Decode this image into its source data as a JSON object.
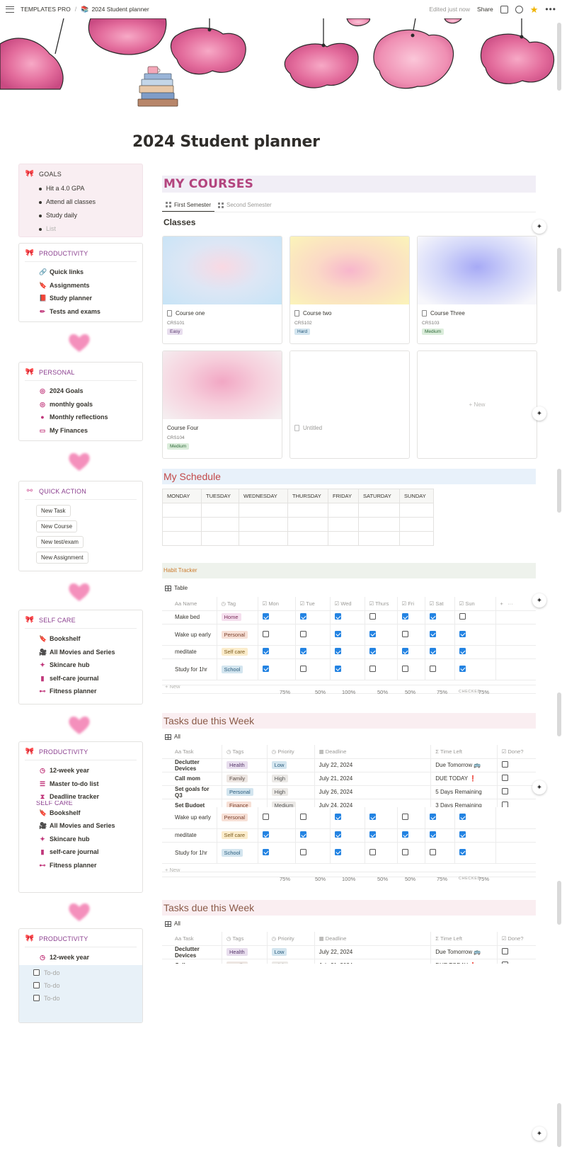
{
  "topbar": {
    "workspace": "TEMPLATES PRO",
    "page": "2024 Student planner",
    "page_emoji": "📚",
    "edited": "Edited just now",
    "share": "Share",
    "icons": [
      "menu-icon",
      "comment-icon",
      "clock-icon",
      "star-icon",
      "more-icon"
    ]
  },
  "title": "2024 Student planner",
  "sidebar": {
    "goals": {
      "header": "GOALS",
      "items": [
        "Hit a 4.0 GPA",
        "Attend all classes",
        "Study daily"
      ],
      "placeholder": "List"
    },
    "productivity": {
      "header": "PRODUCTIVITY",
      "items": [
        "Quick links",
        "Assignments",
        "Study planner",
        "Tests and exams"
      ]
    },
    "personal": {
      "header": "PERSONAL",
      "items": [
        "2024 Goals",
        "monthly goals",
        "Monthly reflections",
        "My Finances"
      ]
    },
    "quick_action": {
      "header": "QUICK ACTION",
      "buttons": [
        "New Task",
        "New Course",
        "New test/exam",
        "New Assignment"
      ]
    },
    "self_care": {
      "header": "SELF CARE",
      "items": [
        "Bookshelf",
        "All Movies and Series",
        "Skincare hub",
        "self-care journal",
        "Fitness planner"
      ]
    },
    "productivity2": {
      "header": "PRODUCTIVITY",
      "items": [
        "12-week year",
        "Master to-do list",
        "Deadline tracker"
      ]
    },
    "self_care2": {
      "header": "SELF CARE",
      "items": [
        "Bookshelf",
        "All Movies and Series",
        "Skincare hub",
        "self-care journal",
        "Fitness planner"
      ]
    },
    "productivity3": {
      "header": "PRODUCTIVITY",
      "items": [
        "12-week year"
      ],
      "todo_placeholder": "To-do"
    }
  },
  "courses": {
    "heading": "MY COURSES",
    "tabs": [
      "First Semester",
      "Second Semester"
    ],
    "subheading": "Classes",
    "cards": [
      {
        "title": "Course one",
        "code": "CRS101",
        "level": "Easy"
      },
      {
        "title": "Course two",
        "code": "CRS102",
        "level": "Hard"
      },
      {
        "title": "Course Three",
        "code": "CRS103",
        "level": "Medium"
      },
      {
        "title": "Course Four",
        "code": "CRS104",
        "level": "Medium"
      },
      {
        "title": "Untitled"
      }
    ],
    "new_label": "+ New"
  },
  "schedule": {
    "heading": "My Schedule",
    "days": [
      "MONDAY",
      "TUESDAY",
      "WEDNESDAY",
      "THURSDAY",
      "FRIDAY",
      "SATURDAY",
      "SUNDAY"
    ]
  },
  "habit": {
    "heading": "Habit Tracker",
    "view": "Table",
    "columns": [
      "Aa Name",
      "Tag",
      "Mon",
      "Tue",
      "Wed",
      "Thurs",
      "Fri",
      "Sat",
      "Sun"
    ],
    "rows": [
      {
        "name": "Make bed",
        "tag": "Home",
        "checks": [
          true,
          true,
          true,
          false,
          true,
          true,
          false
        ]
      },
      {
        "name": "Wake up early",
        "tag": "Personal",
        "checks": [
          false,
          false,
          true,
          true,
          false,
          true,
          true
        ]
      },
      {
        "name": "meditate",
        "tag": "Self care",
        "checks": [
          true,
          true,
          true,
          true,
          true,
          true,
          true
        ]
      },
      {
        "name": "Study for 1hr",
        "tag": "School",
        "checks": [
          true,
          false,
          true,
          false,
          false,
          false,
          true
        ]
      }
    ],
    "new_label": "+ New",
    "calc": [
      "75%",
      "50%",
      "100%",
      "50%",
      "50%",
      "75%",
      "75%"
    ],
    "checked_label": "CHECKED"
  },
  "tasks": {
    "heading": "Tasks due this Week",
    "view": "All",
    "columns": [
      "Aa Task",
      "Tags",
      "Priority",
      "Deadline",
      "Time Left",
      "Done?"
    ],
    "rows": [
      {
        "task": "Declutter Devices",
        "tag": "Health",
        "priority": "Low",
        "deadline": "July 22, 2024",
        "left": "Due Tomorrow 🚌"
      },
      {
        "task": "Call mom",
        "tag": "Family",
        "priority": "High",
        "deadline": "July 21, 2024",
        "left": "DUE TODAY ❗"
      },
      {
        "task": "Set goals for Q3",
        "tag": "Personal",
        "priority": "High",
        "deadline": "July 26, 2024",
        "left": "5 Days Remaining"
      },
      {
        "task": "Set Budget",
        "tag": "Finance",
        "priority": "Medium",
        "deadline": "July 24, 2024",
        "left": "3 Days Remaining"
      }
    ]
  },
  "colors": {
    "accent_pink": "#b3447e",
    "checkbox_blue": "#2383e2",
    "sidebar_purple": "#8b3f8f"
  }
}
